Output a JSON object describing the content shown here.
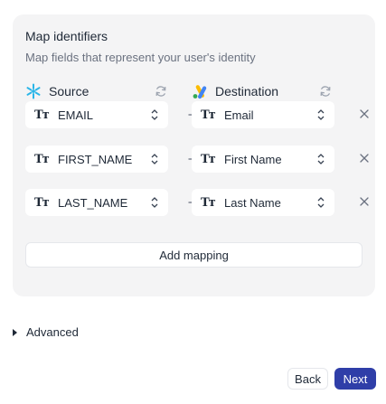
{
  "panel": {
    "title": "Map identifiers",
    "subtitle": "Map fields that represent your user's identity"
  },
  "source": {
    "label": "Source",
    "icon": "snowflake-icon",
    "icon_color": "#29b5e8"
  },
  "destination": {
    "label": "Destination",
    "icon": "google-ads-icon"
  },
  "field_type_glyph": "Tт",
  "mappings": [
    {
      "source": "EMAIL",
      "destination": "Email"
    },
    {
      "source": "FIRST_NAME",
      "destination": "First Name"
    },
    {
      "source": "LAST_NAME",
      "destination": "Last Name"
    }
  ],
  "add_mapping_label": "Add mapping",
  "advanced_label": "Advanced",
  "footer": {
    "back_label": "Back",
    "next_label": "Next"
  },
  "colors": {
    "panel_bg": "#f4f4f5",
    "primary": "#2f3ea8",
    "muted_text": "#6b7280",
    "icon_gray": "#9ca3af"
  }
}
